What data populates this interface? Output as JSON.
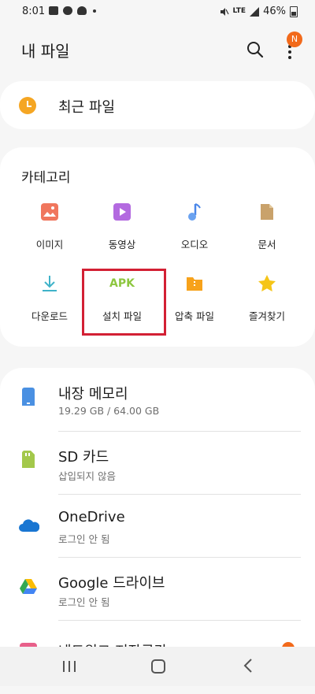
{
  "status_bar": {
    "time": "8:01",
    "network": "LTE",
    "battery": "46%"
  },
  "header": {
    "title": "내 파일",
    "badge": "N"
  },
  "recent": {
    "label": "최근 파일"
  },
  "categories": {
    "heading": "카테고리",
    "items": [
      {
        "label": "이미지",
        "icon": "image-icon",
        "color": "#f0765d"
      },
      {
        "label": "동영상",
        "icon": "video-icon",
        "color": "#b36ae0"
      },
      {
        "label": "오디오",
        "icon": "music-icon",
        "color": "#4a86e8"
      },
      {
        "label": "문서",
        "icon": "document-icon",
        "color": "#c9a26b"
      },
      {
        "label": "다운로드",
        "icon": "download-icon",
        "color": "#3fb3c9"
      },
      {
        "label": "설치 파일",
        "icon": "apk-icon",
        "icon_text": "APK",
        "color": "#8dc63f"
      },
      {
        "label": "압축 파일",
        "icon": "compressed-folder-icon",
        "color": "#f7a21b"
      },
      {
        "label": "즐겨찾기",
        "icon": "star-icon",
        "color": "#f5c518"
      }
    ]
  },
  "storage": [
    {
      "name": "내장 메모리",
      "sub": "19.29 GB / 64.00 GB",
      "icon": "phone-storage-icon",
      "color": "#4a90e2"
    },
    {
      "name": "SD 카드",
      "sub": "삽입되지 않음",
      "icon": "sd-card-icon",
      "color": "#a3c84b"
    },
    {
      "name": "OneDrive",
      "sub": "로그인 안 됨",
      "icon": "onedrive-icon",
      "color": "#1976d2"
    },
    {
      "name": "Google 드라이브",
      "sub": "로그인 안 됨",
      "icon": "google-drive-icon",
      "color": "#34a853"
    },
    {
      "name": "네트워크 저장공간",
      "sub": "",
      "icon": "network-storage-icon",
      "color": "#e8608a"
    }
  ]
}
